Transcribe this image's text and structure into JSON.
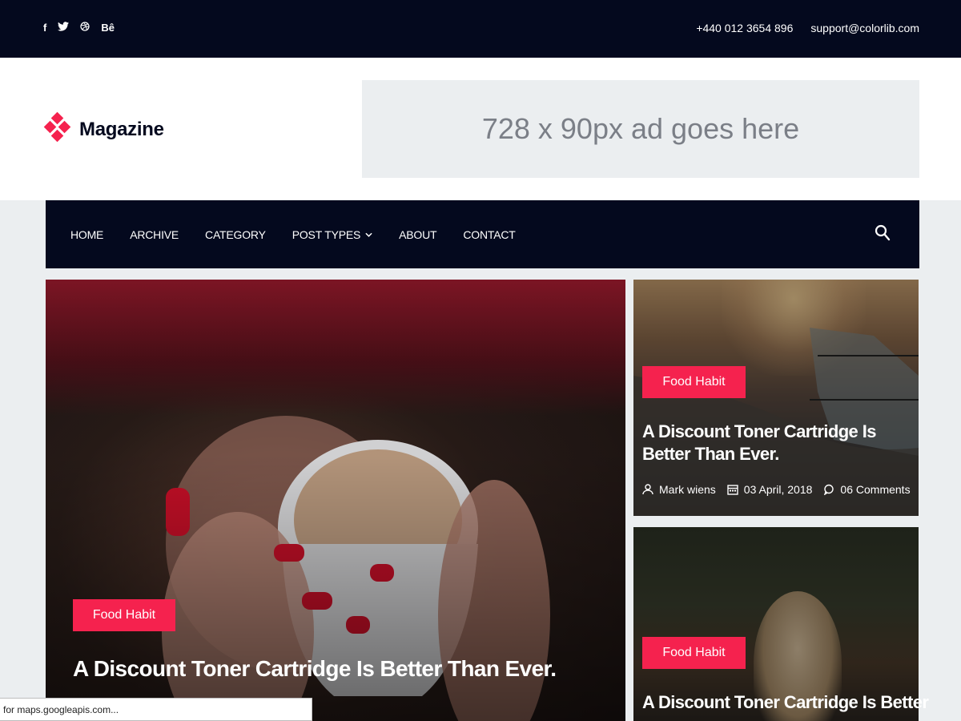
{
  "topbar": {
    "social": [
      "f",
      "𝕥",
      "◎",
      "Bê"
    ],
    "social_names": [
      "facebook-icon",
      "twitter-icon",
      "dribbble-icon",
      "behance-icon"
    ],
    "phone": "+440 012 3654 896",
    "email": "support@colorlib.com"
  },
  "header": {
    "logo_text": "Magazine",
    "ad_text": "728 x 90px ad goes here"
  },
  "nav": {
    "items": [
      "HOME",
      "ARCHIVE",
      "CATEGORY",
      "POST TYPES",
      "ABOUT",
      "CONTACT"
    ],
    "caret": "⌄"
  },
  "hero": {
    "badge": "Food Habit",
    "title": "A Discount Toner Cartridge Is Better Than Ever."
  },
  "card1": {
    "badge": "Food Habit",
    "title": "A Discount Toner Cartridge Is Better Than Ever.",
    "author": "Mark wiens",
    "date": "03 April, 2018",
    "comments": "06 Comments"
  },
  "card2": {
    "badge": "Food Habit",
    "title": "A Discount Toner Cartridge Is Better"
  },
  "statusbar": {
    "text": "for maps.googleapis.com..."
  },
  "colors": {
    "dark": "#04091e",
    "accent": "#f5224e",
    "ad_bg": "#ebeef0"
  }
}
